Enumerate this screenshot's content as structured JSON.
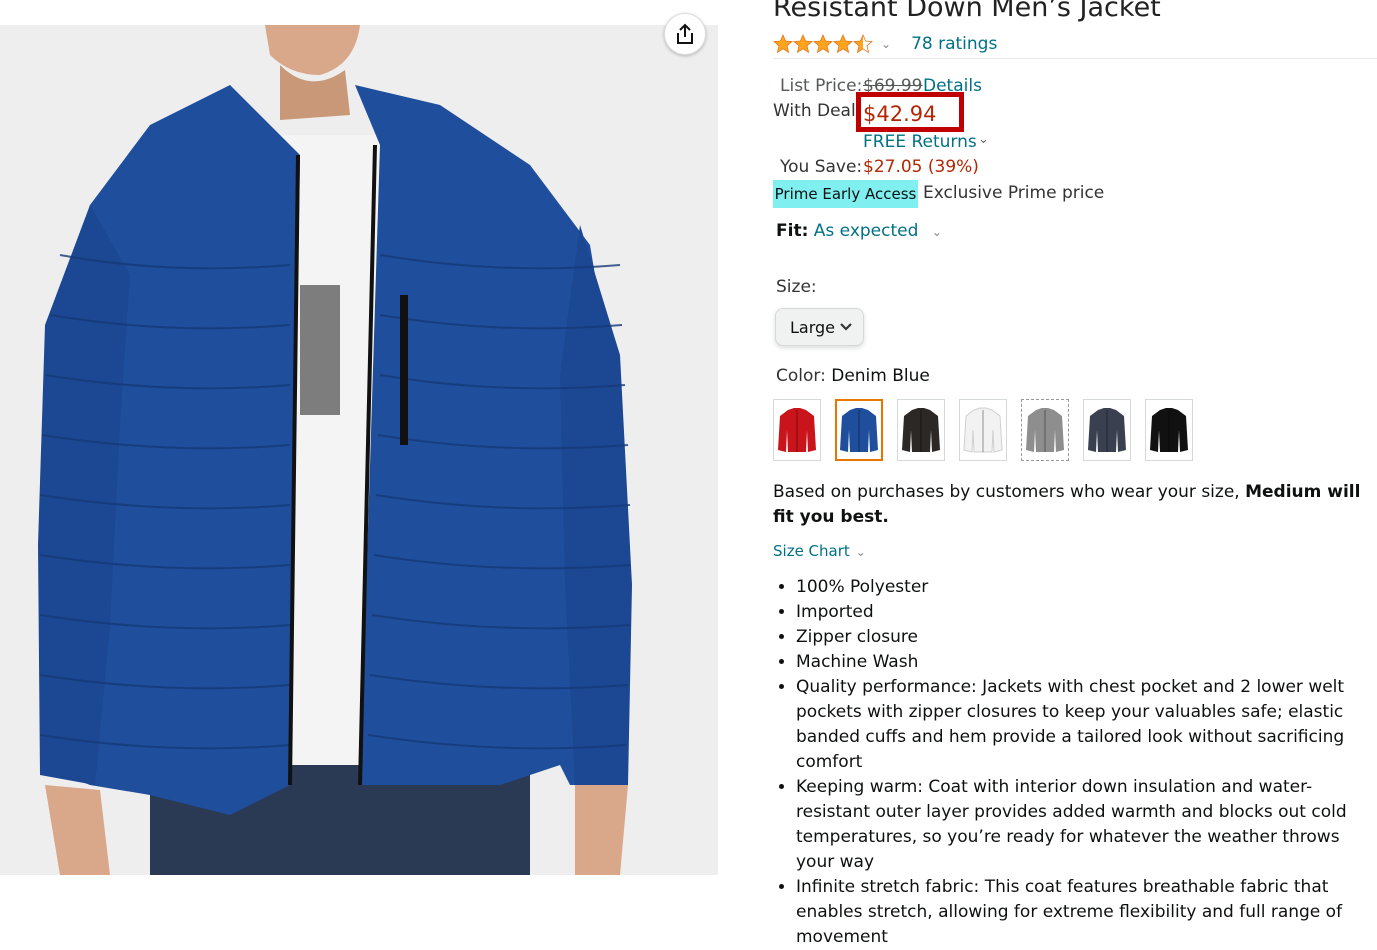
{
  "product": {
    "title": "Resistant Down Men’s Jacket",
    "ratings_text": "78 ratings",
    "rating_stars": 4.5
  },
  "pricing": {
    "list_price_label": "List Price:",
    "list_price": "$69.99",
    "details_link": "Details",
    "deal_label": "With Deal:",
    "deal_price": "$42.94",
    "free_returns": "FREE Returns",
    "save_label": "You Save:",
    "save_value": "$27.05 (39%)",
    "prime_badge": "Prime Early Access",
    "prime_text": "Exclusive Prime price"
  },
  "fit": {
    "label": "Fit:",
    "value": "As expected"
  },
  "size": {
    "label": "Size:",
    "selected": "Large"
  },
  "color": {
    "label": "Color:",
    "selected": "Denim Blue",
    "swatches": [
      {
        "name": "red",
        "hex": "#c8141a"
      },
      {
        "name": "denim-blue",
        "hex": "#1f4e9c"
      },
      {
        "name": "black-brown",
        "hex": "#2b2826"
      },
      {
        "name": "white",
        "hex": "#f2f2f2"
      },
      {
        "name": "grey",
        "hex": "#8e8e8e"
      },
      {
        "name": "camo-navy",
        "hex": "#3a4050"
      },
      {
        "name": "black",
        "hex": "#111111"
      }
    ]
  },
  "recommendation": {
    "text": "Based on purchases by customers who wear your size, ",
    "bold": "Medium will fit you best."
  },
  "size_chart_link": "Size Chart",
  "bullets": [
    "100% Polyester",
    "Imported",
    "Zipper closure",
    "Machine Wash",
    "Quality performance: Jackets with chest pocket and 2 lower welt pockets with zipper closures to keep your valuables safe; elastic banded cuffs and hem provide a tailored look without sacrificing comfort",
    "Keeping warm: Coat with interior down insulation and water-resistant outer layer provides added warmth and blocks out cold temperatures, so you’re ready for whatever the weather throws your way",
    "Infinite stretch fabric: This coat features breathable fabric that enables stretch, allowing for extreme flexibility and full range of movement"
  ],
  "colors": {
    "jacket": "#1f4e9c",
    "link": "#007185",
    "price_red": "#b12704",
    "highlight": "#c00000",
    "prime_badge_bg": "#7fefef",
    "star": "#ffa41c"
  }
}
